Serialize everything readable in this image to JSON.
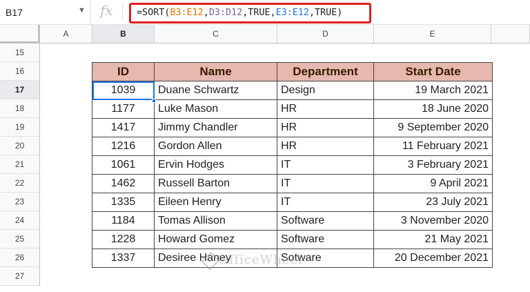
{
  "formula_bar": {
    "cell_ref": "B17",
    "fx_symbol": "fx",
    "formula_parts": [
      {
        "text": "=SORT(",
        "color": "default"
      },
      {
        "text": "B3:E12",
        "color": "orange"
      },
      {
        "text": ",",
        "color": "default"
      },
      {
        "text": "D3:D12",
        "color": "purple"
      },
      {
        "text": ",TRUE,",
        "color": "default"
      },
      {
        "text": "E3:E12",
        "color": "blue"
      },
      {
        "text": ",TRUE)",
        "color": "default"
      }
    ]
  },
  "columns": [
    "A",
    "B",
    "C",
    "D",
    "E"
  ],
  "rows": [
    "15",
    "16",
    "17",
    "18",
    "19",
    "20",
    "21",
    "22",
    "23",
    "24",
    "25",
    "26",
    "27"
  ],
  "active_cell": {
    "column": "B",
    "row": "17"
  },
  "table": {
    "headers": [
      "ID",
      "Name",
      "Department",
      "Start Date"
    ],
    "rows": [
      [
        "1039",
        "Duane Schwartz",
        "Design",
        "19 March 2021"
      ],
      [
        "1177",
        "Luke Mason",
        "HR",
        "18 June 2020"
      ],
      [
        "1417",
        "Jimmy Chandler",
        "HR",
        "9 September 2020"
      ],
      [
        "1216",
        "Gordon Allen",
        "HR",
        "11 February 2021"
      ],
      [
        "1061",
        "Ervin Hodges",
        "IT",
        "3 February 2021"
      ],
      [
        "1462",
        "Russell Barton",
        "IT",
        "9 April 2021"
      ],
      [
        "1335",
        "Eileen Henry",
        "IT",
        "23 July 2021"
      ],
      [
        "1184",
        "Tomas Allison",
        "Software",
        "3 November 2020"
      ],
      [
        "1228",
        "Howard Gomez",
        "Software",
        "21 May 2021"
      ],
      [
        "1337",
        "Desiree Haney",
        "Sotware",
        "20 December 2021"
      ]
    ],
    "header_color": "#e6b8af",
    "selection_color": "#1a73e8",
    "formula_highlight_color": "#e01e1e"
  },
  "watermark": "OfficeWheel"
}
